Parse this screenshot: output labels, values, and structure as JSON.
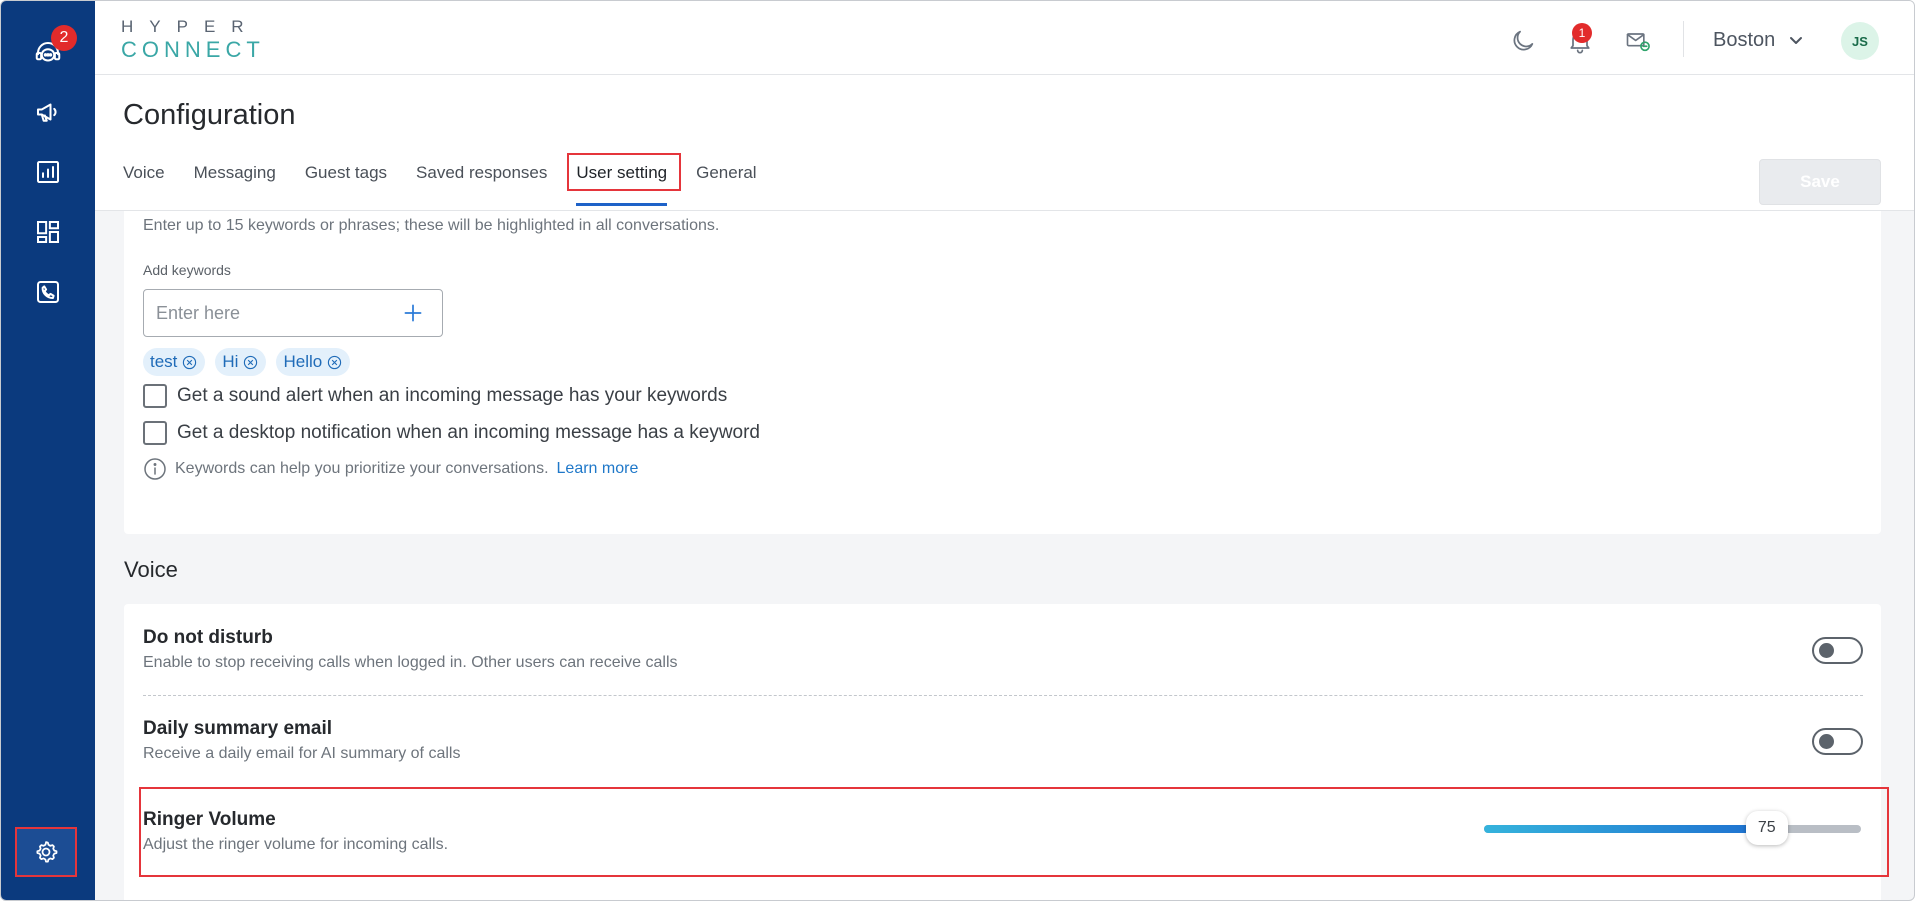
{
  "sidebar": {
    "badge_count": "2",
    "items": [
      {
        "icon": "support-agent-icon"
      },
      {
        "icon": "megaphone-icon"
      },
      {
        "icon": "reports-icon"
      },
      {
        "icon": "dashboard-icon"
      },
      {
        "icon": "phone-icon"
      }
    ],
    "settings_icon": "gear-icon"
  },
  "header": {
    "logo_top": "HYPER",
    "logo_bottom": "CONNECT",
    "notification_count": "1",
    "location": "Boston",
    "avatar_initials": "JS"
  },
  "page": {
    "title": "Configuration",
    "tabs": [
      "Voice",
      "Messaging",
      "Guest tags",
      "Saved responses",
      "User setting",
      "General"
    ],
    "active_tab": "User setting",
    "save_label": "Save"
  },
  "keywords": {
    "description": "Enter up to 15 keywords or phrases; these will be highlighted in all conversations.",
    "field_label": "Add keywords",
    "placeholder": "Enter here",
    "chips": [
      "test",
      "Hi",
      "Hello"
    ],
    "sound_alert_label": "Get a sound alert when an incoming message has your keywords",
    "desktop_notification_label": "Get a desktop notification when an incoming message has a keyword",
    "info_text": "Keywords can help you prioritize your conversations.",
    "learn_more": "Learn more"
  },
  "voice": {
    "section_title": "Voice",
    "dnd_title": "Do not disturb",
    "dnd_desc": "Enable to stop receiving calls when logged in. Other users can receive calls",
    "summary_title": "Daily summary email",
    "summary_desc": "Receive a daily email for AI summary of calls",
    "ringer_title": "Ringer Volume",
    "ringer_desc": "Adjust the ringer volume for incoming calls.",
    "ringer_value": "75"
  },
  "colors": {
    "sidebar": "#0b3a7e",
    "accent_blue": "#1e62c8",
    "highlight_red": "#e5353b",
    "badge_red": "#e22b2b"
  }
}
